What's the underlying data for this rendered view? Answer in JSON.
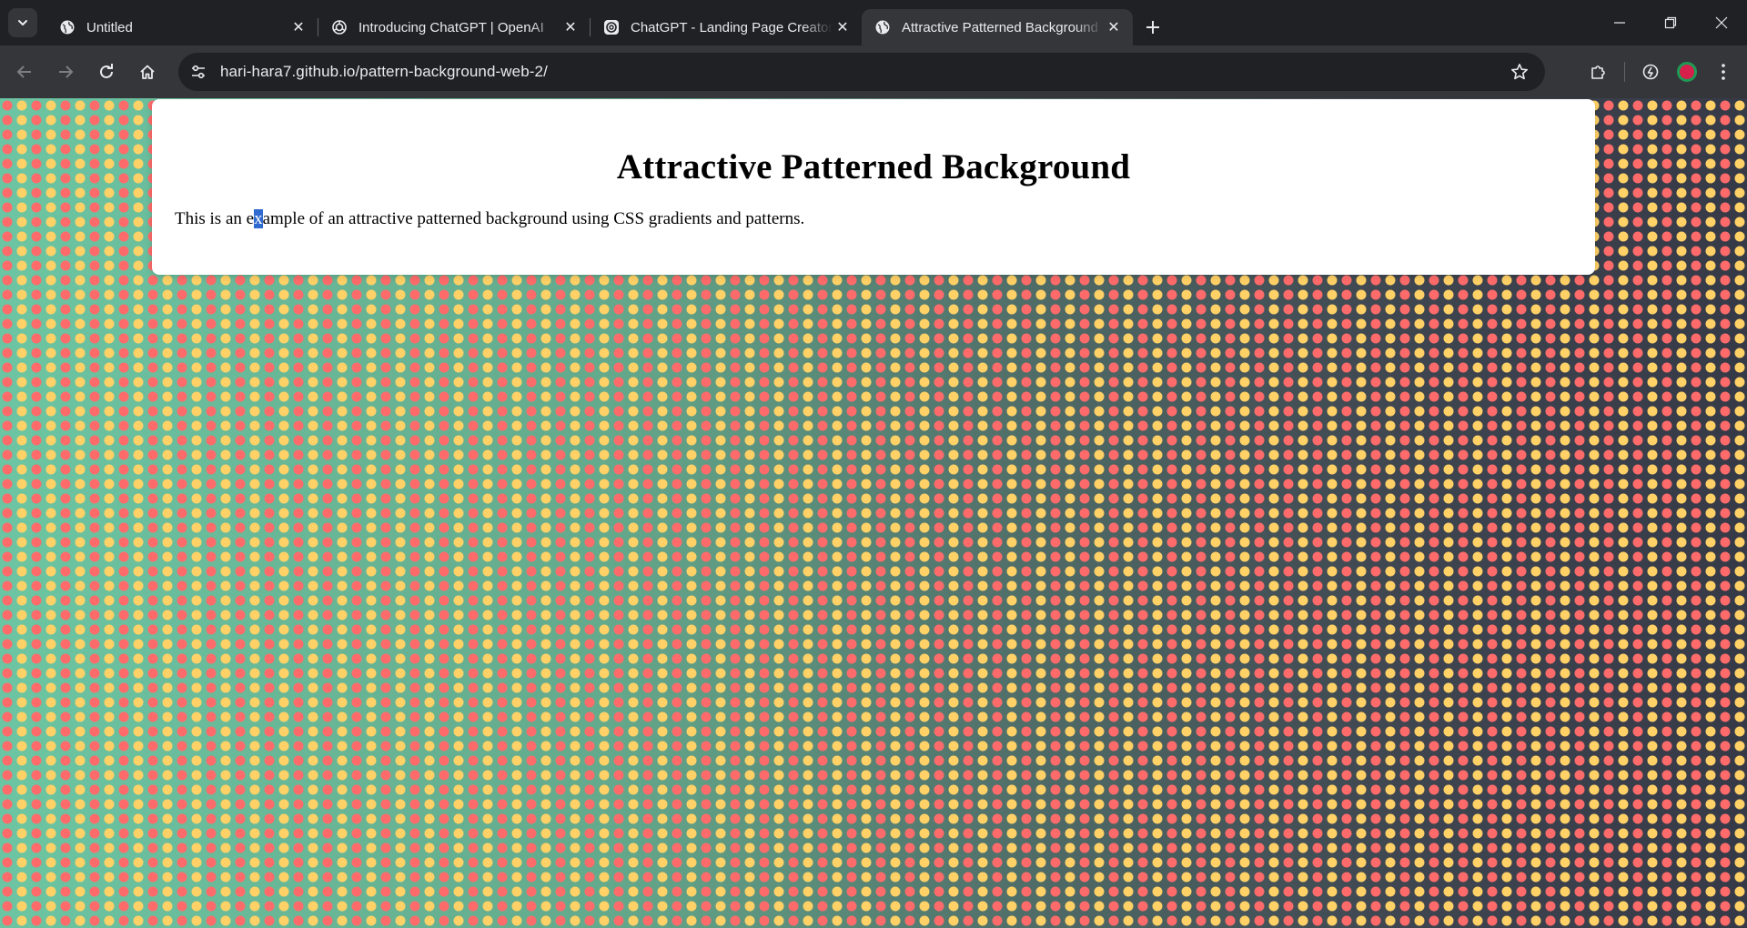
{
  "browser": {
    "tabs": [
      {
        "title": "Untitled",
        "favicon": "globe-icon",
        "active": false
      },
      {
        "title": "Introducing ChatGPT | OpenAI",
        "favicon": "openai-icon",
        "active": false
      },
      {
        "title": "ChatGPT - Landing Page Creator",
        "favicon": "openai-icon",
        "active": false
      },
      {
        "title": "Attractive Patterned Background",
        "favicon": "globe-icon",
        "active": true
      }
    ],
    "url": "hari-hara7.github.io/pattern-background-web-2/"
  },
  "page": {
    "heading": "Attractive Patterned Background",
    "paragraph_before_selection": "This is an e",
    "paragraph_selected": "x",
    "paragraph_after_selection": "ample of an attractive patterned background using CSS gradients and patterns."
  },
  "colors": {
    "dot_red": "#ff6b6b",
    "dot_yellow": "#ffd166",
    "gradient_start": "#6cc5a2",
    "gradient_end": "#363a47",
    "selection": "#2f6ad0"
  }
}
